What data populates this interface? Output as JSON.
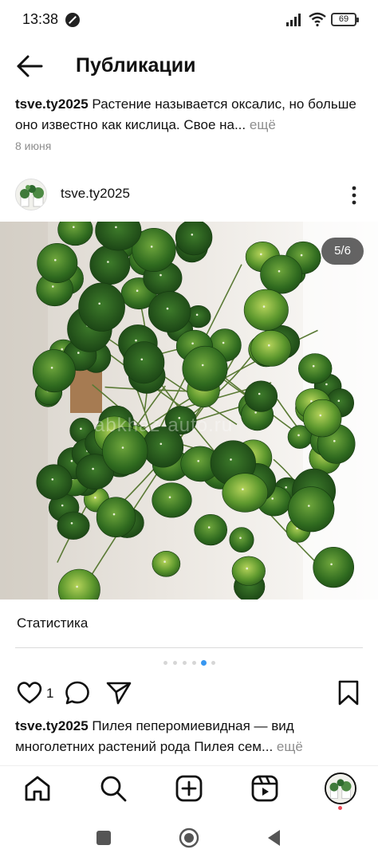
{
  "status_bar": {
    "time": "13:38",
    "battery": "69"
  },
  "header": {
    "title": "Публикации"
  },
  "previous_post": {
    "username": "tsve.ty2025",
    "caption": "Растение называется оксалис, но больше оно известно как кислица. Свое на...",
    "more": "ещё",
    "date": "8 июня"
  },
  "post": {
    "username": "tsve.ty2025",
    "page_counter": "5/6",
    "watermark": "abkhaz-auto.ru",
    "stats_label": "Статистика",
    "carousel": {
      "total": 6,
      "current": 5
    },
    "likes": "1",
    "caption": "Пилея пеперомиевидная — вид многолетних растений рода Пилея сем...",
    "more": "ещё"
  },
  "icons": {
    "back": "arrow-left-icon",
    "more": "three-dots-vertical-icon",
    "like": "heart-icon",
    "comment": "comment-bubble-icon",
    "share": "paper-plane-icon",
    "save": "bookmark-icon",
    "home": "home-icon",
    "search": "search-icon",
    "create": "plus-square-icon",
    "reels": "reels-icon"
  },
  "colors": {
    "accent_dot": "#3897f0",
    "notification": "#ed4956",
    "muted_text": "#8e8e8e"
  }
}
